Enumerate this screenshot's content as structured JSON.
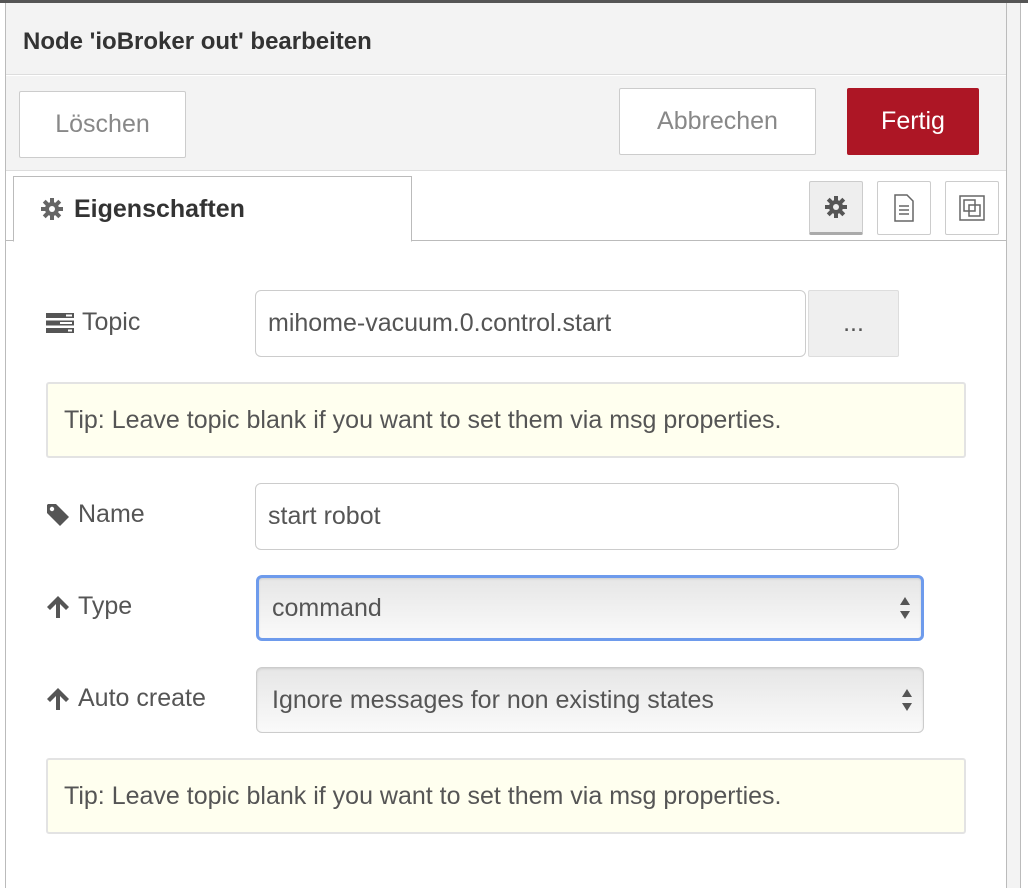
{
  "header": {
    "title": "Node 'ioBroker out' bearbeiten"
  },
  "toolbar": {
    "delete_label": "Löschen",
    "cancel_label": "Abbrechen",
    "done_label": "Fertig"
  },
  "tabs": {
    "properties_label": "Eigenschaften",
    "icons": [
      "gear-icon",
      "document-icon",
      "layout-icon"
    ]
  },
  "form": {
    "topic": {
      "label": "Topic",
      "value": "mihome-vacuum.0.control.start",
      "browse_label": "..."
    },
    "tip1": "Tip: Leave topic blank if you want to set them via msg properties.",
    "name": {
      "label": "Name",
      "value": "start robot"
    },
    "type": {
      "label": "Type",
      "value": "command"
    },
    "autocreate": {
      "label": "Auto create",
      "value": "Ignore messages for non existing states"
    },
    "tip2": "Tip: Leave topic blank if you want to set them via msg properties."
  },
  "colors": {
    "primary": "#ad1625",
    "focus": "#6e9bec",
    "tip_bg": "#ffffef"
  }
}
